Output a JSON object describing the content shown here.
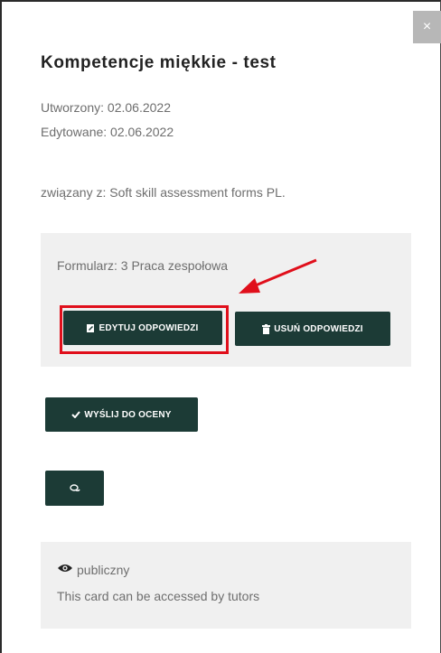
{
  "modal": {
    "close_label": "×",
    "title": "Kompetencje miękkie - test",
    "created": "Utworzony: 02.06.2022",
    "edited": "Edytowane: 02.06.2022",
    "related": "związany z: Soft skill assessment forms PL."
  },
  "form_panel": {
    "form_label": "Formularz: 3 Praca zespołowa",
    "edit_button": "EDYTUJ ODPOWIEDZI",
    "delete_button": "USUŃ ODPOWIEDZI"
  },
  "actions": {
    "send_button": "WYŚLIJ DO OCENY"
  },
  "visibility": {
    "status": "publiczny",
    "description": "This card can be accessed by tutors"
  },
  "colors": {
    "button_bg": "#1c3b36",
    "highlight": "#e00f1b",
    "panel_bg": "#f0f0f0"
  },
  "icons": [
    "close-icon",
    "edit-icon",
    "trash-icon",
    "check-icon",
    "comments-icon",
    "eye-icon",
    "arrow-annotation"
  ]
}
